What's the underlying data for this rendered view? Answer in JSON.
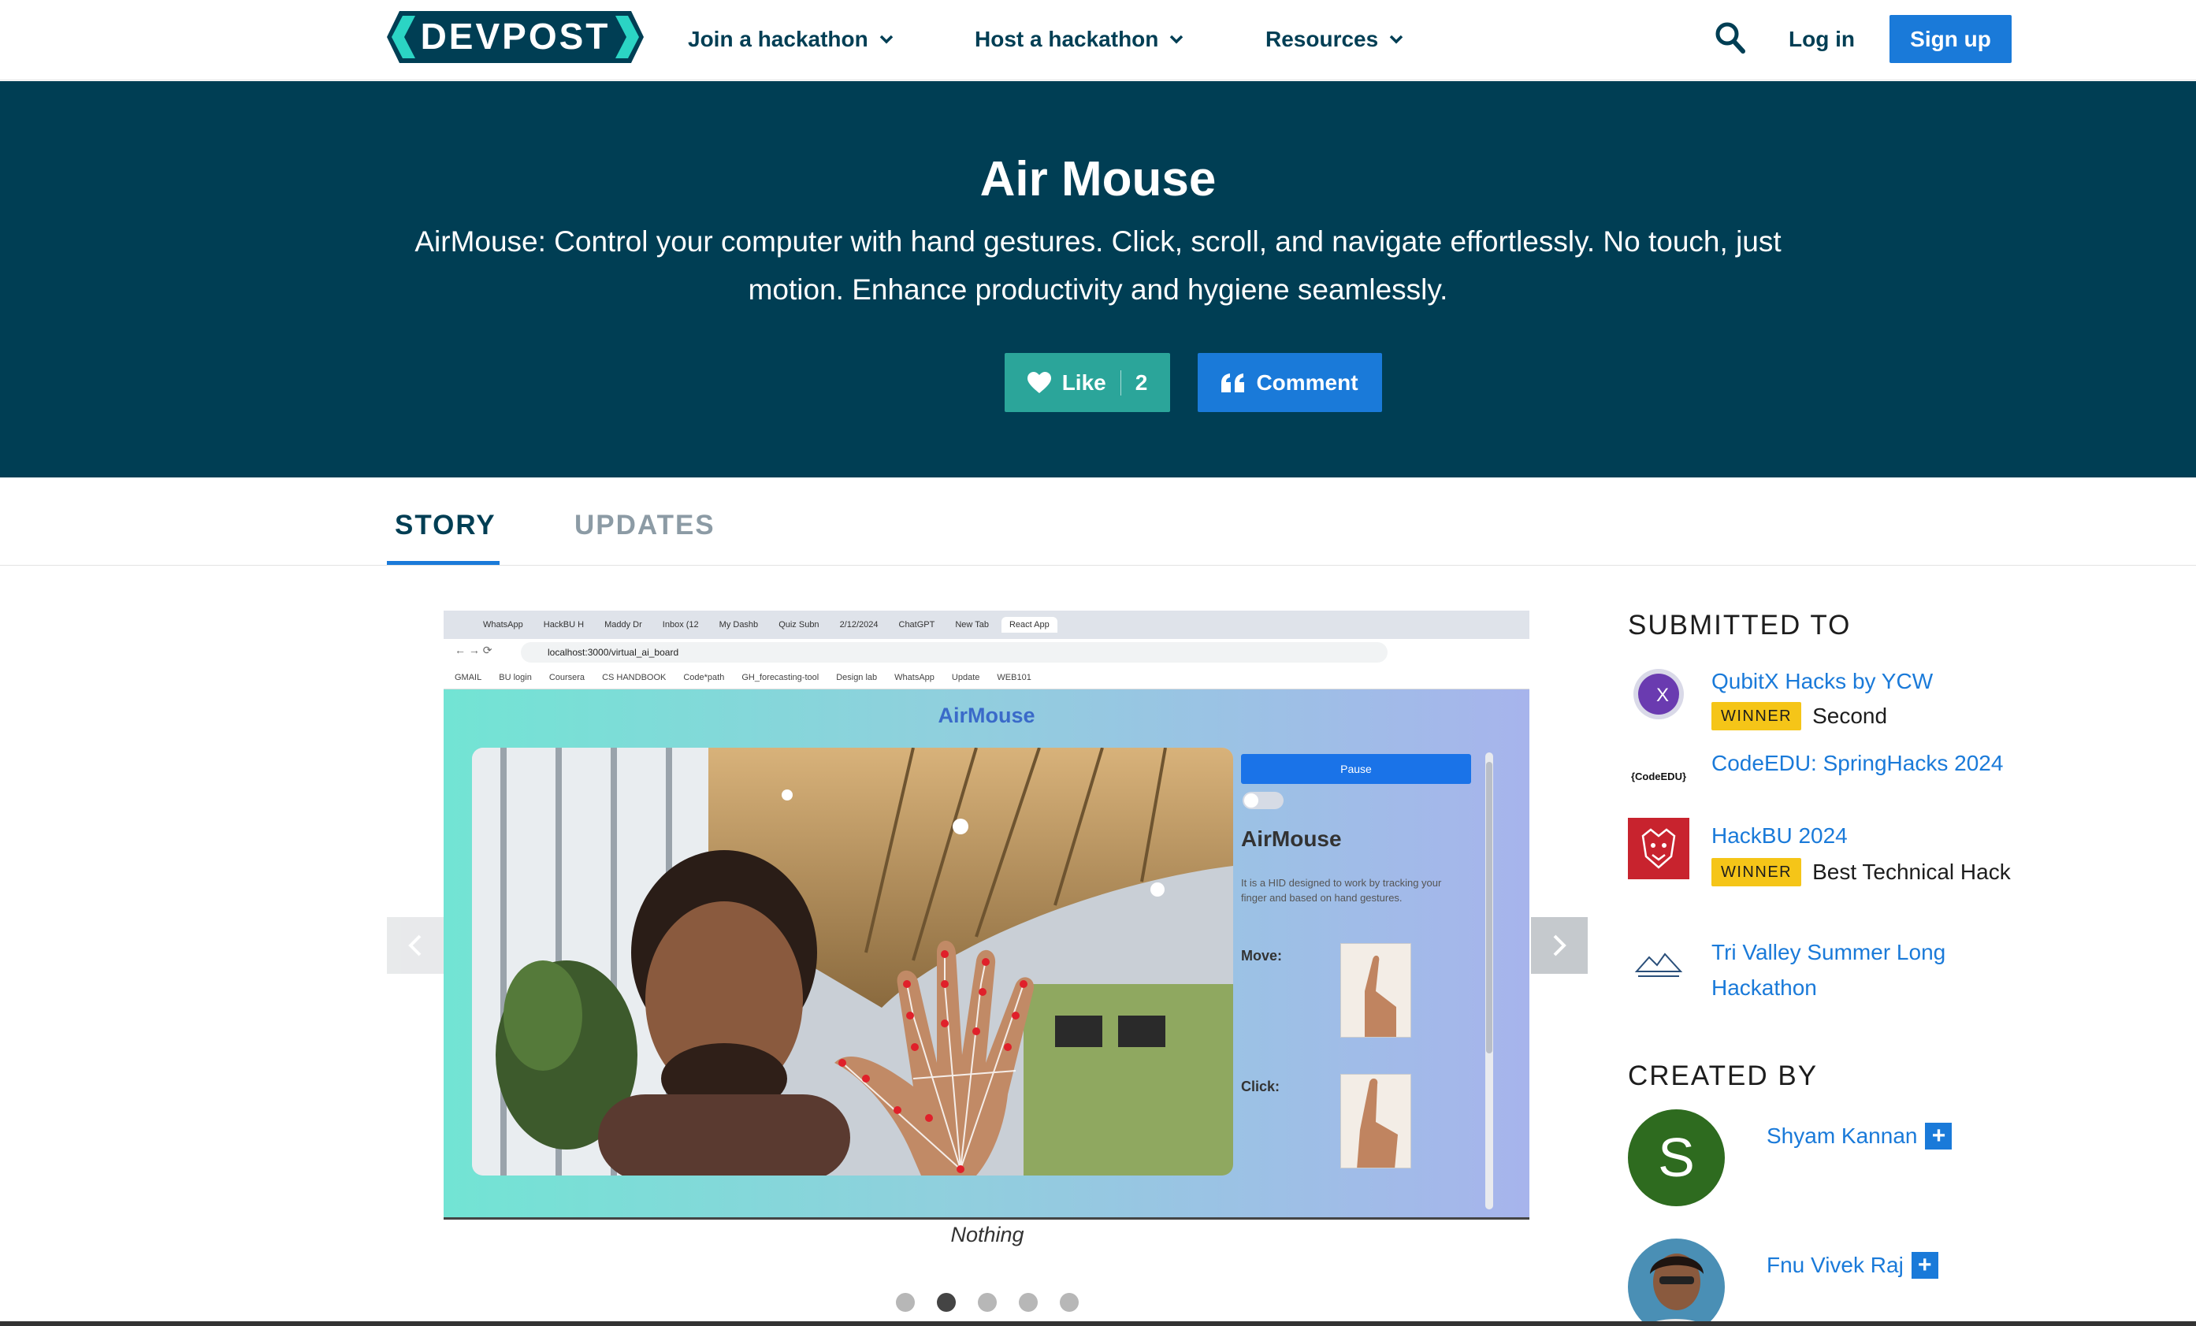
{
  "header": {
    "logo_text": "DEVPOST",
    "nav": [
      "Join a hackathon",
      "Host a hackathon",
      "Resources"
    ],
    "login": "Log in",
    "signup": "Sign up"
  },
  "hero": {
    "title": "Air Mouse",
    "tagline": "AirMouse: Control your computer with hand gestures. Click, scroll, and navigate effortlessly. No touch, just motion. Enhance productivity and hygiene seamlessly.",
    "like_label": "Like",
    "like_count": "2",
    "comment_label": "Comment"
  },
  "tabs": [
    "STORY",
    "UPDATES"
  ],
  "gallery": {
    "caption": "Nothing",
    "dot_count": 5,
    "active_dot": 1,
    "slide": {
      "browser_tabs": [
        "WhatsApp",
        "HackBU H",
        "Maddy Dr",
        "Inbox (12",
        "My Dashb",
        "Quiz Subn",
        "2/12/2024",
        "ChatGPT",
        "New Tab",
        "React App"
      ],
      "url": "localhost:3000/virtual_ai_board",
      "bookmarks": [
        "GMAIL",
        "BU login",
        "Coursera",
        "CS HANDBOOK",
        "Code*path",
        "GH_forecasting-tool",
        "Design lab",
        "WhatsApp",
        "Update",
        "WEB101"
      ],
      "app_title": "AirMouse",
      "pause_label": "Pause",
      "panel_title": "AirMouse",
      "panel_desc": "It is a HID designed to work by tracking your finger and based on hand gestures.",
      "move_label": "Move:",
      "click_label": "Click:"
    }
  },
  "sidebar": {
    "submitted_heading": "SUBMITTED TO",
    "submissions": [
      {
        "name": "QubitX Hacks by YCW",
        "badge": "WINNER",
        "prize": "Second"
      },
      {
        "name": "CodeEDU: SpringHacks 2024",
        "logo_text": "{CodeEDU}"
      },
      {
        "name": "HackBU 2024",
        "badge": "WINNER",
        "prize": "Best Technical Hack"
      },
      {
        "name": "Tri Valley Summer Long Hackathon"
      }
    ],
    "created_heading": "CREATED BY",
    "creators": [
      {
        "name": "Shyam Kannan",
        "initial": "S"
      },
      {
        "name": "Fnu Vivek Raj"
      }
    ]
  },
  "colors": {
    "brand_dark": "#003e54",
    "brand_blue": "#1a7ad9",
    "like_teal": "#2ba59a",
    "winner_yellow": "#f5c518"
  }
}
